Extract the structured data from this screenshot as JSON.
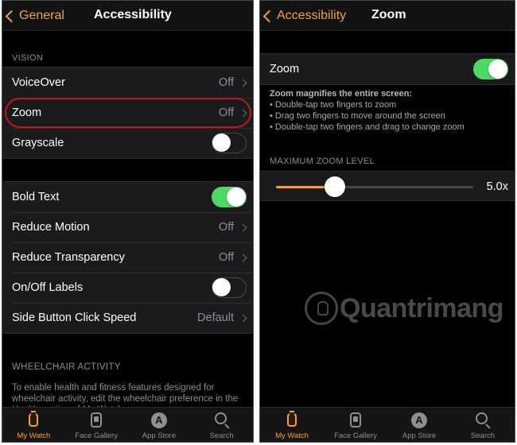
{
  "left_screen": {
    "nav": {
      "back_label": "General",
      "title": "Accessibility"
    },
    "vision_header": "VISION",
    "vision_rows": [
      {
        "label": "VoiceOver",
        "value": "Off"
      },
      {
        "label": "Zoom",
        "value": "Off"
      },
      {
        "label": "Grayscale"
      }
    ],
    "display_rows": [
      {
        "label": "Bold Text"
      },
      {
        "label": "Reduce Motion",
        "value": "Off"
      },
      {
        "label": "Reduce Transparency",
        "value": "Off"
      },
      {
        "label": "On/Off Labels"
      },
      {
        "label": "Side Button Click Speed",
        "value": "Default"
      }
    ],
    "toggles": {
      "grayscale": false,
      "bold_text": true,
      "onoff_labels": false
    },
    "wheelchair_header": "WHEELCHAIR ACTIVITY",
    "wheelchair_text": "To enable health and fitness features designed for wheelchair activity, edit the wheelchair preference in the Health section of My Watch."
  },
  "right_screen": {
    "nav": {
      "back_label": "Accessibility",
      "title": "Zoom"
    },
    "zoom_row_label": "Zoom",
    "zoom_enabled": true,
    "description": {
      "title": "Zoom magnifies the entire screen:",
      "bullets": [
        "Double-tap two fingers to zoom",
        "Drag two fingers to move around the screen",
        "Double-tap two fingers and drag to change zoom"
      ]
    },
    "max_zoom_header": "MAXIMUM ZOOM LEVEL",
    "max_zoom_value": "5.0x",
    "slider_fraction": 0.3
  },
  "tabbar": [
    {
      "label": "My Watch",
      "icon": "watch-icon",
      "active": true
    },
    {
      "label": "Face Gallery",
      "icon": "face-gallery-icon",
      "active": false
    },
    {
      "label": "App Store",
      "icon": "app-store-icon",
      "active": false
    },
    {
      "label": "Search",
      "icon": "search-icon",
      "active": false
    }
  ],
  "watermark": "Quantrimang",
  "colors": {
    "accent": "#f0a13b",
    "toggle_on": "#4cd964",
    "highlight": "#c0161d",
    "background": "#000000"
  }
}
